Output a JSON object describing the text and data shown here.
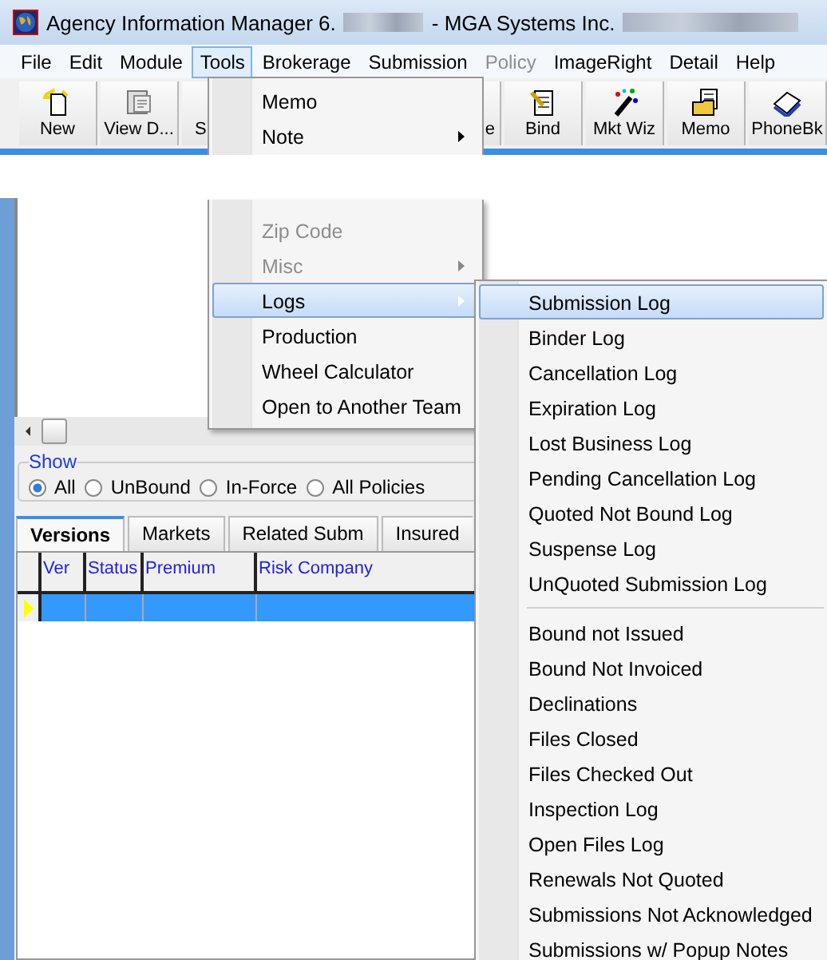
{
  "window": {
    "title_start": "Agency Information Manager 6.",
    "title_end": "- MGA Systems Inc."
  },
  "menu_bar": [
    {
      "label": "File",
      "selected": false,
      "disabled": false
    },
    {
      "label": "Edit",
      "selected": false,
      "disabled": false
    },
    {
      "label": "Module",
      "selected": false,
      "disabled": false
    },
    {
      "label": "Tools",
      "selected": true,
      "disabled": false
    },
    {
      "label": "Brokerage",
      "selected": false,
      "disabled": false
    },
    {
      "label": "Submission",
      "selected": false,
      "disabled": false
    },
    {
      "label": "Policy",
      "selected": false,
      "disabled": true
    },
    {
      "label": "ImageRight",
      "selected": false,
      "disabled": false
    },
    {
      "label": "Detail",
      "selected": false,
      "disabled": false
    },
    {
      "label": "Help",
      "selected": false,
      "disabled": false
    }
  ],
  "toolbar": [
    {
      "label": "New",
      "kind": "new"
    },
    {
      "label": "View D...",
      "kind": "view"
    },
    {
      "label": "S",
      "kind": "covered_right"
    },
    {
      "label": "e",
      "kind": "covered_left"
    },
    {
      "label": "Bind",
      "kind": "bind"
    },
    {
      "label": "Mkt Wiz",
      "kind": "wizard"
    },
    {
      "label": "Memo",
      "kind": "memo"
    },
    {
      "label": "PhoneBk",
      "kind": "phonebook"
    }
  ],
  "tools_menu": {
    "upper_items": [
      {
        "label": "Memo",
        "submenu": false,
        "disabled": false,
        "selected": false
      },
      {
        "label": "Note",
        "submenu": true,
        "disabled": false,
        "selected": false
      }
    ],
    "lower_items": [
      {
        "label": "Zip Code",
        "submenu": false,
        "disabled": true,
        "selected": false
      },
      {
        "label": "Misc",
        "submenu": true,
        "disabled": true,
        "selected": false
      },
      {
        "label": "Logs",
        "submenu": true,
        "disabled": false,
        "selected": true
      },
      {
        "label": "Production",
        "submenu": false,
        "disabled": false,
        "selected": false
      },
      {
        "label": "Wheel Calculator",
        "submenu": false,
        "disabled": false,
        "selected": false
      },
      {
        "label": "Open to Another Team",
        "submenu": false,
        "disabled": false,
        "selected": false
      }
    ]
  },
  "logs_menu": [
    {
      "kind": "item",
      "label": "Submission Log",
      "selected": true
    },
    {
      "kind": "item",
      "label": "Binder Log",
      "selected": false
    },
    {
      "kind": "item",
      "label": "Cancellation Log",
      "selected": false
    },
    {
      "kind": "item",
      "label": "Expiration Log",
      "selected": false
    },
    {
      "kind": "item",
      "label": "Lost Business Log",
      "selected": false
    },
    {
      "kind": "item",
      "label": "Pending Cancellation Log",
      "selected": false
    },
    {
      "kind": "item",
      "label": "Quoted Not Bound Log",
      "selected": false
    },
    {
      "kind": "item",
      "label": "Suspense Log",
      "selected": false
    },
    {
      "kind": "item",
      "label": "UnQuoted Submission Log",
      "selected": false
    },
    {
      "kind": "separator"
    },
    {
      "kind": "item",
      "label": "Bound not Issued",
      "selected": false
    },
    {
      "kind": "item",
      "label": "Bound Not Invoiced",
      "selected": false
    },
    {
      "kind": "item",
      "label": "Declinations",
      "selected": false
    },
    {
      "kind": "item",
      "label": "Files Closed",
      "selected": false
    },
    {
      "kind": "item",
      "label": "Files Checked Out",
      "selected": false
    },
    {
      "kind": "item",
      "label": "Inspection Log",
      "selected": false
    },
    {
      "kind": "item",
      "label": "Open Files Log",
      "selected": false
    },
    {
      "kind": "item",
      "label": "Renewals Not Quoted",
      "selected": false
    },
    {
      "kind": "item",
      "label": "Submissions Not Acknowledged",
      "selected": false
    },
    {
      "kind": "item",
      "label": "Submissions w/ Popup Notes",
      "selected": false
    }
  ],
  "show_filter": {
    "legend": "Show",
    "options": [
      {
        "label": "All",
        "selected": true
      },
      {
        "label": "UnBound",
        "selected": false
      },
      {
        "label": "In-Force",
        "selected": false
      },
      {
        "label": "All Policies",
        "selected": false
      }
    ]
  },
  "tabs": [
    {
      "label": "Versions",
      "selected": true
    },
    {
      "label": "Markets",
      "selected": false
    },
    {
      "label": "Related Subm",
      "selected": false
    },
    {
      "label": "Insured",
      "selected": false
    }
  ],
  "grid": {
    "columns": [
      "Ver",
      "Status",
      "Premium",
      "Risk Company"
    ],
    "rows": [
      {
        "selected": true
      }
    ]
  }
}
